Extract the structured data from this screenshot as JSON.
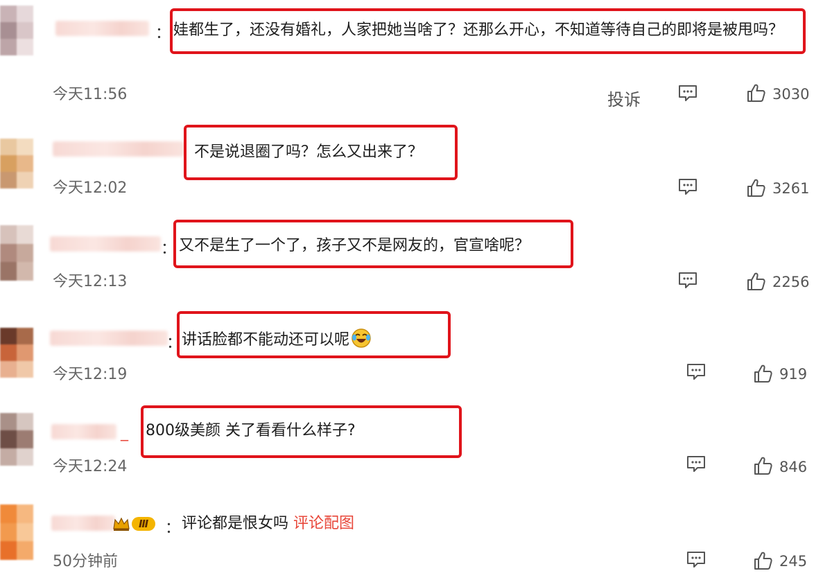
{
  "comments": [
    {
      "text": "娃都生了，还没有婚礼，人家把她当啥了？还那么开心，不知道等待自己的即将是被甩吗？",
      "time": "今天11:56",
      "report": "投诉",
      "likes": "3030"
    },
    {
      "text": "不是说退圈了吗？怎么又出来了？",
      "time": "今天12:02",
      "likes": "3261"
    },
    {
      "text": "又不是生了一个了，孩子又不是网友的，官宣啥呢？",
      "time": "今天12:13",
      "likes": "2256"
    },
    {
      "text": "讲话脸都不能动还可以呢",
      "emoji": "laughing-crying-emoji",
      "time": "今天12:19",
      "likes": "919"
    },
    {
      "text": "800级美颜 关了看看什么样子?",
      "time": "今天12:24",
      "likes": "846"
    },
    {
      "badge_level": "Ⅲ",
      "text": "评论都是恨女吗",
      "image_link": "评论配图",
      "time": "50分钟前",
      "likes": "245"
    }
  ],
  "colon": "：",
  "colors": {
    "highlight_border": "#e0141b",
    "link": "#e8473a",
    "meta_text": "#666666"
  },
  "icons": [
    "reply-icon",
    "like-icon",
    "crown-icon"
  ]
}
